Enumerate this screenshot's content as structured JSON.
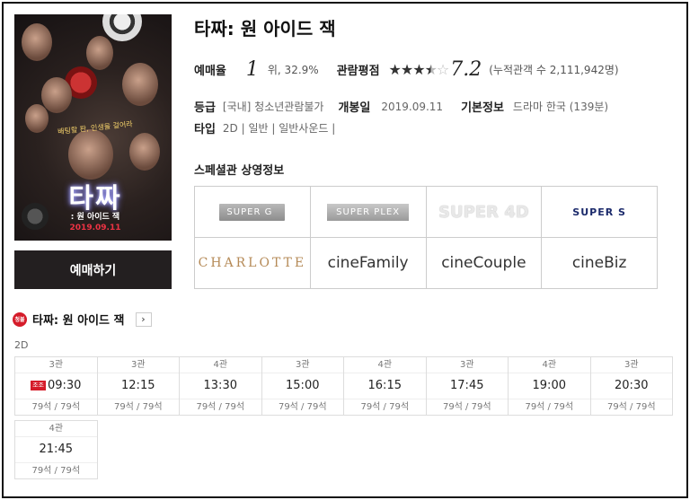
{
  "movie": {
    "title": "타짜: 원 아이드 잭",
    "poster": {
      "tagline": "배팅할 판, 인생을 걸어라",
      "title_text": "타짜",
      "subtitle": ": 원 아이드 잭",
      "date_text": "2019.09.11"
    },
    "book_button": "예매하기",
    "booking_rate": {
      "label": "예매율",
      "rank": "1",
      "rest": "위, 32.9%"
    },
    "rating": {
      "label": "관람평점",
      "stars_filled": 3.5,
      "stars_total": 5,
      "score": "7.2",
      "cumulative": "(누적관객 수 2,111,942명)"
    },
    "grade": {
      "label": "등급",
      "value": "[국내] 청소년관람불가"
    },
    "release": {
      "label": "개봉일",
      "value": "2019.09.11"
    },
    "basic": {
      "label": "기본정보",
      "value": "드라마 한국 (139분)"
    },
    "type": {
      "label": "타입",
      "value": "2D | 일반 | 일반사운드 |"
    }
  },
  "special": {
    "title": "스페셜관 상영정보",
    "halls": [
      {
        "name": "SUPER G",
        "text": "SUPER G"
      },
      {
        "name": "SUPER PLEX",
        "text": "SUPER PLEX"
      },
      {
        "name": "SUPER 4D",
        "text": "SUPER 4D"
      },
      {
        "name": "SUPER S",
        "text": "SUPER S"
      },
      {
        "name": "CHARLOTTE",
        "text": "CHARLOTTE"
      },
      {
        "name": "cineFamily",
        "text": "cineFamily"
      },
      {
        "name": "cineCouple",
        "text": "cineCouple"
      },
      {
        "name": "cineBiz",
        "text": "cineBiz"
      }
    ]
  },
  "schedule": {
    "age_badge": "청불",
    "title": "타짜: 원 아이드 잭",
    "arrow": "›",
    "format": "2D",
    "rows": [
      [
        {
          "hall": "3관",
          "time": "09:30",
          "tag": "조조",
          "seats": "79석 / 79석"
        },
        {
          "hall": "3관",
          "time": "12:15",
          "tag": "",
          "seats": "79석 / 79석"
        },
        {
          "hall": "4관",
          "time": "13:30",
          "tag": "",
          "seats": "79석 / 79석"
        },
        {
          "hall": "3관",
          "time": "15:00",
          "tag": "",
          "seats": "79석 / 79석"
        },
        {
          "hall": "4관",
          "time": "16:15",
          "tag": "",
          "seats": "79석 / 79석"
        },
        {
          "hall": "3관",
          "time": "17:45",
          "tag": "",
          "seats": "79석 / 79석"
        },
        {
          "hall": "4관",
          "time": "19:00",
          "tag": "",
          "seats": "79석 / 79석"
        },
        {
          "hall": "3관",
          "time": "20:30",
          "tag": "",
          "seats": "79석 / 79석"
        }
      ],
      [
        {
          "hall": "4관",
          "time": "21:45",
          "tag": "",
          "seats": "79석 / 79석"
        }
      ]
    ]
  },
  "colors": {
    "accent": "#d51c2a",
    "button": "#231f20"
  }
}
